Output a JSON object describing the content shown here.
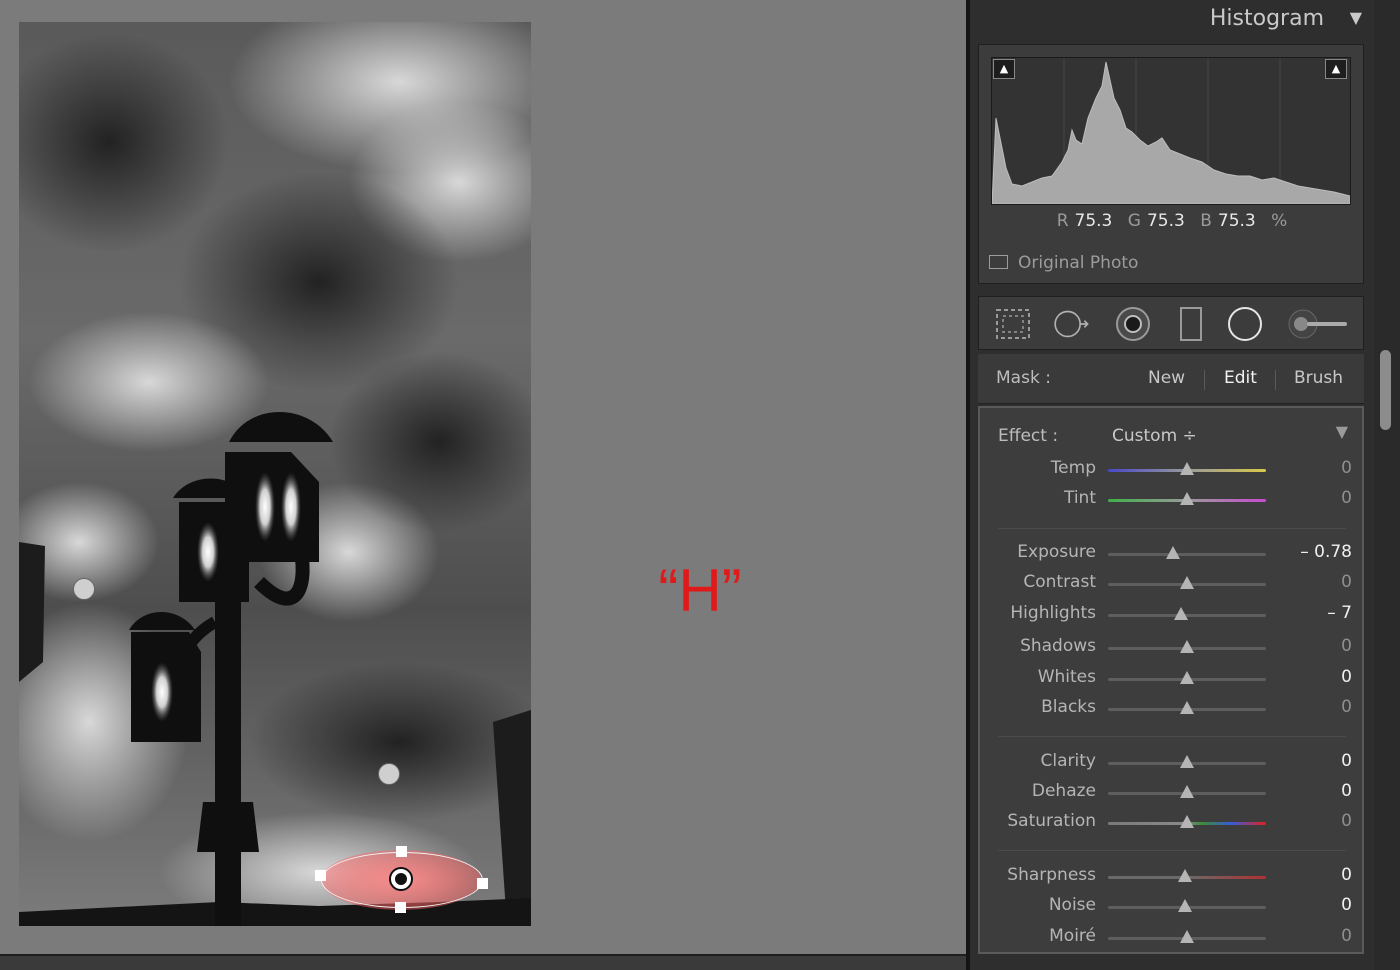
{
  "annotation": "“H”",
  "histogram": {
    "title": "Histogram",
    "collapse_icon": "triangle-down-icon",
    "readout": {
      "r_label": "R",
      "r": "75.3",
      "g_label": "G",
      "g": "75.3",
      "b_label": "B",
      "b": "75.3",
      "unit": "%"
    },
    "original_photo_label": "Original Photo"
  },
  "toolstrip": [
    "crop-overlay-icon",
    "spot-removal-icon",
    "red-eye-icon",
    "graduated-filter-icon",
    "radial-filter-icon",
    "adjustment-brush-icon"
  ],
  "mask": {
    "label": "Mask :",
    "options": [
      "New",
      "Edit",
      "Brush"
    ],
    "active": "Edit"
  },
  "effect": {
    "label": "Effect :",
    "value": "Custom ÷",
    "collapse_icon": "triangle-down-icon"
  },
  "sliders": [
    {
      "label": "Temp",
      "value": "0",
      "pos": 0.5,
      "strong": false,
      "track": "temp"
    },
    {
      "label": "Tint",
      "value": "0",
      "pos": 0.5,
      "strong": false,
      "track": "tint"
    },
    {
      "label": "Exposure",
      "value": "– 0.78",
      "pos": 0.41,
      "strong": true,
      "track": "plain"
    },
    {
      "label": "Contrast",
      "value": "0",
      "pos": 0.5,
      "strong": false,
      "track": "plain"
    },
    {
      "label": "Highlights",
      "value": "– 7",
      "pos": 0.465,
      "strong": true,
      "track": "plain"
    },
    {
      "label": "Shadows",
      "value": "0",
      "pos": 0.5,
      "strong": false,
      "track": "plain"
    },
    {
      "label": "Whites",
      "value": "0",
      "pos": 0.5,
      "strong": true,
      "track": "plain"
    },
    {
      "label": "Blacks",
      "value": "0",
      "pos": 0.5,
      "strong": false,
      "track": "plain"
    },
    {
      "label": "Clarity",
      "value": "0",
      "pos": 0.5,
      "strong": true,
      "track": "plain"
    },
    {
      "label": "Dehaze",
      "value": "0",
      "pos": 0.5,
      "strong": true,
      "track": "plain"
    },
    {
      "label": "Saturation",
      "value": "0",
      "pos": 0.5,
      "strong": false,
      "track": "saturation"
    },
    {
      "label": "Sharpness",
      "value": "0",
      "pos": 0.49,
      "strong": true,
      "track": "sharpness"
    },
    {
      "label": "Noise",
      "value": "0",
      "pos": 0.49,
      "strong": true,
      "track": "plain"
    },
    {
      "label": "Moiré",
      "value": "0",
      "pos": 0.5,
      "strong": false,
      "track": "plain"
    }
  ],
  "colors": {
    "panel": "#2e2e2e",
    "annotation": "#e01a1a",
    "mask_overlay": "#ff7a7a"
  }
}
